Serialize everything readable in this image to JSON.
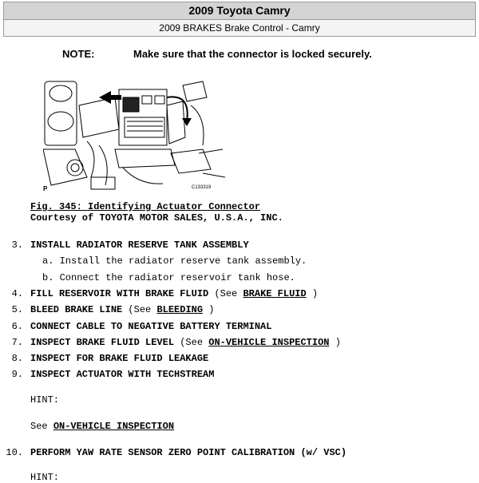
{
  "header": {
    "title": "2009 Toyota Camry",
    "subtitle": "2009 BRAKES Brake Control - Camry"
  },
  "note": {
    "label": "NOTE:",
    "text": "Make sure that the connector is locked securely."
  },
  "figure": {
    "corner_label": "P",
    "code": "C133319",
    "caption": "Fig. 345: Identifying Actuator Connector",
    "courtesy": "Courtesy of TOYOTA MOTOR SALES, U.S.A., INC."
  },
  "steps": [
    {
      "num": "3.",
      "text": "INSTALL RADIATOR RESERVE TANK ASSEMBLY"
    },
    {
      "num": "4.",
      "text": "FILL RESERVOIR WITH BRAKE FLUID",
      "pre": "(See ",
      "link": "BRAKE FLUID",
      "post": ")"
    },
    {
      "num": "5.",
      "text": "BLEED BRAKE LINE",
      "pre": "(See ",
      "link": "BLEEDING",
      "post": ")"
    },
    {
      "num": "6.",
      "text": "CONNECT CABLE TO NEGATIVE BATTERY TERMINAL"
    },
    {
      "num": "7.",
      "text": "INSPECT BRAKE FLUID LEVEL",
      "pre": "(See ",
      "link": "ON-VEHICLE INSPECTION",
      "post": ")"
    },
    {
      "num": "8.",
      "text": "INSPECT FOR BRAKE FLUID LEAKAGE"
    },
    {
      "num": "9.",
      "text": "INSPECT ACTUATOR WITH TECHSTREAM"
    },
    {
      "num": "10.",
      "text": "PERFORM YAW RATE SENSOR ZERO POINT CALIBRATION (w/ VSC)"
    }
  ],
  "substeps": [
    "a. Install the radiator reserve tank assembly.",
    "b. Connect the radiator reservoir tank hose."
  ],
  "hint_label": "HINT:",
  "see_prefix": "See ",
  "see_link": "ON-VEHICLE INSPECTION"
}
